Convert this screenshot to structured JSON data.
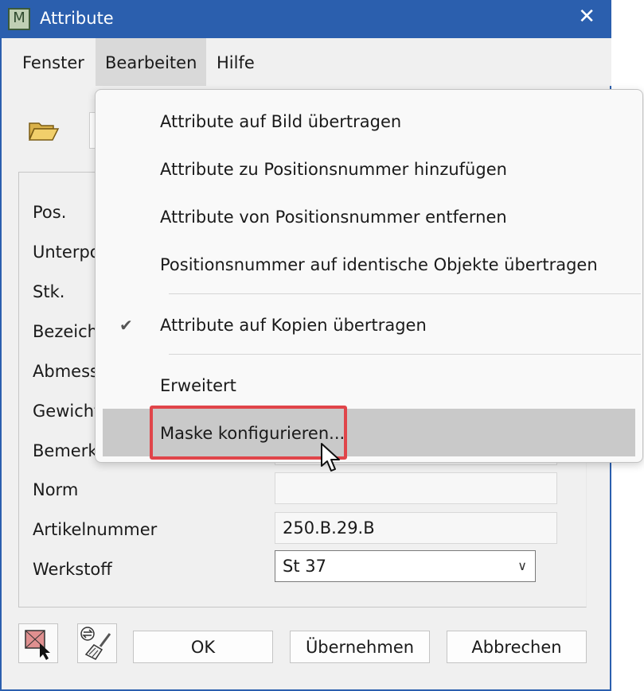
{
  "window": {
    "title": "Attribute",
    "app_icon_letter": "M",
    "close_glyph": "✕"
  },
  "menubar": {
    "items": [
      {
        "label": "Fenster"
      },
      {
        "label": "Bearbeiten"
      },
      {
        "label": "Hilfe"
      }
    ]
  },
  "form": {
    "fields": [
      {
        "label": "Pos.",
        "value": ""
      },
      {
        "label": "Unterpos",
        "value": ""
      },
      {
        "label": "Stk.",
        "value": ""
      },
      {
        "label": "Bezeich",
        "value": ""
      },
      {
        "label": "Abmess",
        "value": ""
      },
      {
        "label": "Gewicht",
        "value": ""
      },
      {
        "label": "Bemerk",
        "value": ""
      },
      {
        "label": "Norm",
        "value": ""
      },
      {
        "label": "Artikelnummer",
        "value": "250.B.29.B"
      },
      {
        "label": "Werkstoff",
        "value": "St 37"
      }
    ]
  },
  "buttons": {
    "ok": "OK",
    "apply": "Übernehmen",
    "cancel": "Abbrechen"
  },
  "dropdown": {
    "items": [
      {
        "label": "Attribute auf Bild übertragen"
      },
      {
        "label": "Attribute zu Positionsnummer hinzufügen"
      },
      {
        "label": "Attribute von Positionsnummer entfernen"
      },
      {
        "label": "Positionsnummer auf identische Objekte übertragen"
      },
      {
        "label": "Attribute auf Kopien übertragen",
        "checked": true
      },
      {
        "label": "Erweitert"
      },
      {
        "label": "Maske konfigurieren..."
      }
    ],
    "check_glyph": "✔"
  },
  "colors": {
    "titlebar": "#2b5fae",
    "highlight": "#e0454a",
    "menu_hover": "#c9c9c9"
  }
}
